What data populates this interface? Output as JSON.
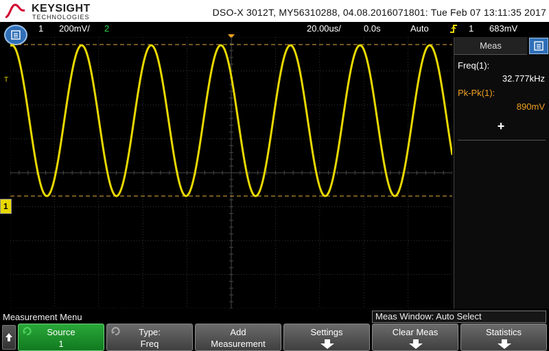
{
  "header": {
    "brand": "KEYSIGHT",
    "brand_sub": "TECHNOLOGIES",
    "device_info": "DSO-X 3012T, MY56310288, 04.08.2016071801: Tue Feb 07 13:11:35 2017"
  },
  "status": {
    "ch1_number": "1",
    "ch1_scale": "200mV/",
    "ch2_number": "2",
    "timebase": "20.00us/",
    "delay": "0.0s",
    "trigger_mode": "Auto",
    "trigger_source": "1",
    "trigger_level": "683mV"
  },
  "scope": {
    "trigger_level_marker": "T",
    "channel_marker": "1",
    "colors": {
      "ch1": "#e8d800",
      "trigger_line": "#e8b040",
      "grid": "#4a4a4a",
      "trigger_marker": "#f0a020"
    },
    "waveform": {
      "type": "sine",
      "cycles_visible": 6.35,
      "frequency_khz": 32.777,
      "peak_to_peak_mv": 890
    }
  },
  "side_panel": {
    "tab_label": "Meas",
    "measurements": [
      {
        "label": "Freq(1):",
        "value": "32.777kHz",
        "color": "#ffffff"
      },
      {
        "label": "Pk-Pk(1):",
        "value": "890mV",
        "color": "#f0a020"
      }
    ],
    "add_symbol": "+"
  },
  "menu": {
    "title": "Measurement Menu",
    "meas_window": "Meas Window: Auto Select",
    "softkeys": [
      {
        "line1": "Source",
        "line2": "1"
      },
      {
        "line1": "Type:",
        "line2": "Freq"
      },
      {
        "line1": "Add",
        "line2": "Measurement"
      },
      {
        "line1": "Settings",
        "line2": ""
      },
      {
        "line1": "Clear Meas",
        "line2": ""
      },
      {
        "line1": "Statistics",
        "line2": ""
      }
    ]
  }
}
